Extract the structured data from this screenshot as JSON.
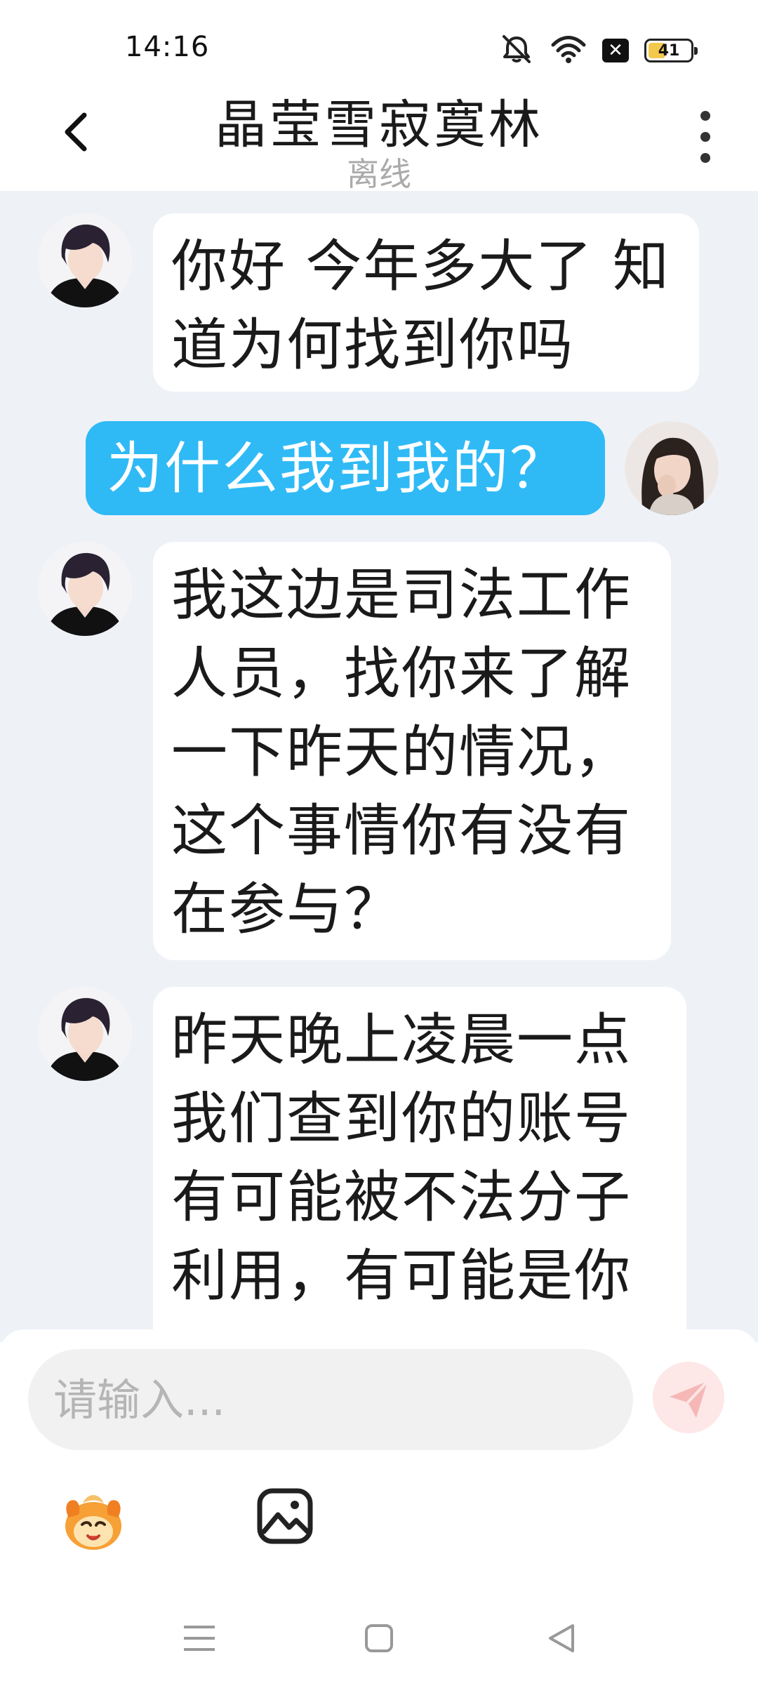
{
  "status_bar": {
    "time": "14:16",
    "battery_level": "41"
  },
  "header": {
    "title": "晶莹雪寂寞林",
    "subtitle": "离线"
  },
  "messages": [
    {
      "sender": "other",
      "text": "你好 今年多大了 知\n道为何找到你吗"
    },
    {
      "sender": "me",
      "text": "为什么我到我的？"
    },
    {
      "sender": "other",
      "text": "我这边是司法工作\n人员，找你来了解\n一下昨天的情况，\n这个事情你有没有\n在参与？"
    },
    {
      "sender": "other",
      "text": "昨天晚上凌晨一点\n我们查到你的账号\n有可能被不法分子\n利用，有可能是你\n"
    }
  ],
  "input": {
    "placeholder": "请输入..."
  },
  "icons": {
    "back": "chevron-left-icon",
    "more": "more-vertical-icon",
    "send": "paper-plane-icon",
    "emoji": "emoji-mascot-icon",
    "image": "image-icon"
  },
  "colors": {
    "accent": "#2fbaf6",
    "chat_bg": "#eef2f7",
    "send_button": "#fde7e7",
    "battery": "#f2c94c"
  }
}
